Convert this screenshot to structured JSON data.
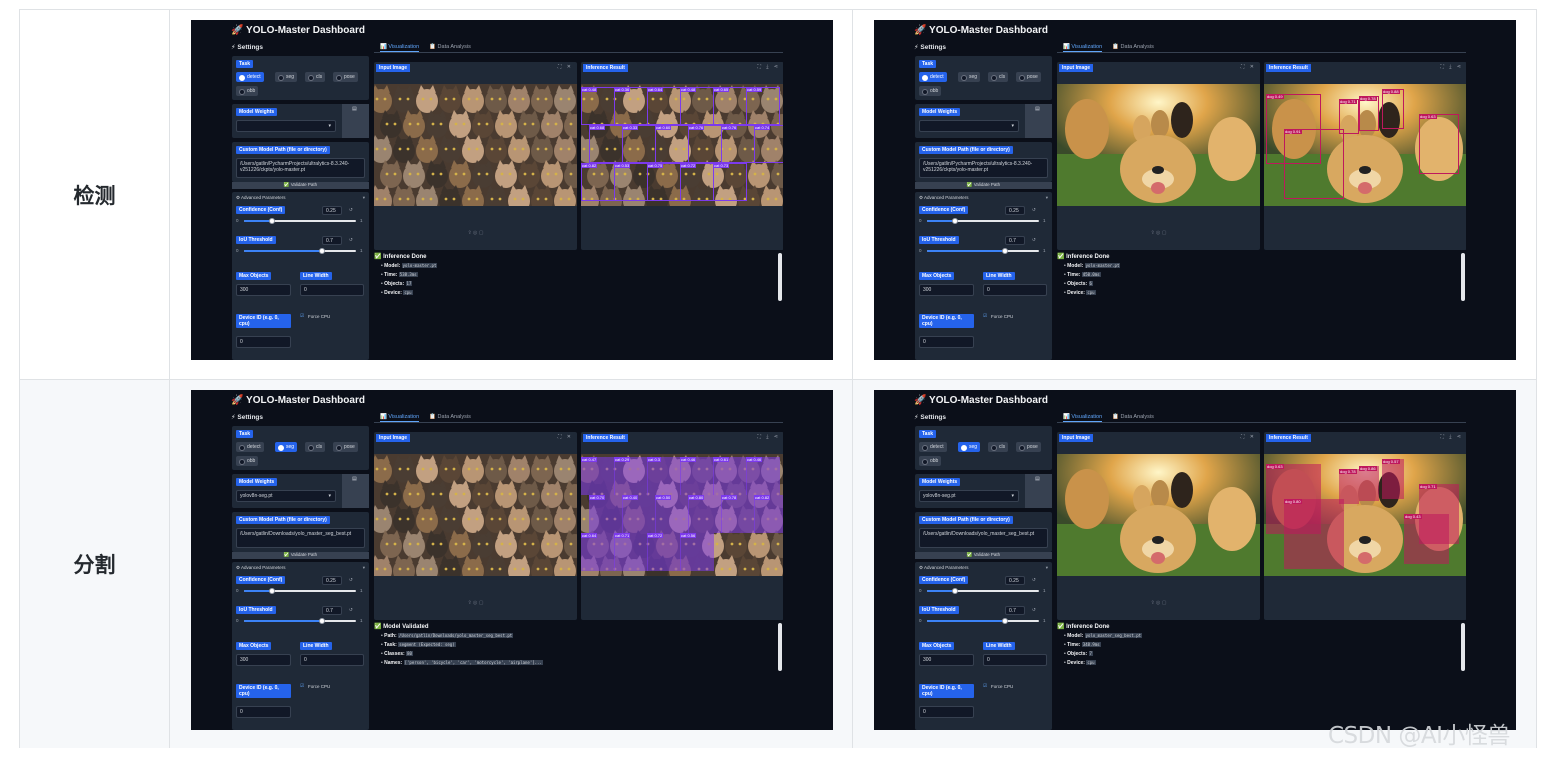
{
  "rows": [
    {
      "label": "检测",
      "shots": [
        {
          "app_title": "🚀 YOLO-Master Dashboard",
          "settings_heading": "⚡ Settings",
          "tabs": [
            "📊 Visualization",
            "📋 Data Analysis"
          ],
          "task_label": "Task",
          "task_options": [
            "detect",
            "seg",
            "cls",
            "pose",
            "obb"
          ],
          "task_selected": "detect",
          "weights_label": "Model Weights",
          "weights_value": "",
          "custom_path_label": "Custom Model Path (file or directory)",
          "custom_path_value": "/Users/gatlin/PycharmProjects/ultralytics-8.3.240-v251226/ckpts/yolo-master.pt",
          "validate_label": "✅ Validate Path",
          "advanced_label": "⚙ Advanced Parameters",
          "conf_label": "Confidence (Conf)",
          "conf_value": "0.25",
          "conf_level": 0.25,
          "iou_label": "IoU Threshold",
          "iou_value": "0.7",
          "iou_level": 0.7,
          "max_obj_label": "Max Objects",
          "max_obj_value": "300",
          "line_width_label": "Line Width",
          "line_width_value": "0",
          "device_label": "Device ID (e.g. 0, cpu)",
          "device_value": "0",
          "force_cpu_label": "Force CPU",
          "input_label": "Input Image",
          "result_label": "Inference Result",
          "image_kind": "cats",
          "result_mode": "det",
          "status_title": "✅ Inference Done",
          "status_items": [
            {
              "k": "Model:",
              "v": "yolo-master.pt"
            },
            {
              "k": "Time:",
              "v": "538.3ms"
            },
            {
              "k": "Objects:",
              "v": "17"
            },
            {
              "k": "Device:",
              "v": "cpu"
            }
          ],
          "det_labels": [
            "cat 0.48",
            "cat 0.36",
            "cat 0.64",
            "cat 0.48",
            "cat 0.65",
            "cat 0.59",
            "cat 0.68",
            "cat 0.33",
            "cat 0.60",
            "cat 0.76",
            "cat 0.76",
            "cat 0.74",
            "cat 0.82",
            "cat 0.53",
            "cat 0.75",
            "cat 0.72",
            "cat 0.73"
          ]
        },
        {
          "app_title": "🚀 YOLO-Master Dashboard",
          "settings_heading": "⚡ Settings",
          "tabs": [
            "📊 Visualization",
            "📋 Data Analysis"
          ],
          "task_label": "Task",
          "task_options": [
            "detect",
            "seg",
            "cls",
            "pose",
            "obb"
          ],
          "task_selected": "detect",
          "weights_label": "Model Weights",
          "weights_value": "",
          "custom_path_label": "Custom Model Path (file or directory)",
          "custom_path_value": "/Users/gatlin/PycharmProjects/ultralytics-8.3.240-v251226/ckpts/yolo-master.pt",
          "validate_label": "✅ Validate Path",
          "advanced_label": "⚙ Advanced Parameters",
          "conf_label": "Confidence (Conf)",
          "conf_value": "0.25",
          "conf_level": 0.25,
          "iou_label": "IoU Threshold",
          "iou_value": "0.7",
          "iou_level": 0.7,
          "max_obj_label": "Max Objects",
          "max_obj_value": "300",
          "line_width_label": "Line Width",
          "line_width_value": "0",
          "device_label": "Device ID (e.g. 0, cpu)",
          "device_value": "0",
          "force_cpu_label": "Force CPU",
          "input_label": "Input Image",
          "result_label": "Inference Result",
          "image_kind": "dogs",
          "result_mode": "det",
          "status_title": "✅ Inference Done",
          "status_items": [
            {
              "k": "Model:",
              "v": "yolo-master.pt"
            },
            {
              "k": "Time:",
              "v": "450.0ms"
            },
            {
              "k": "Objects:",
              "v": "6"
            },
            {
              "k": "Device:",
              "v": "cpu"
            }
          ],
          "det_labels": [
            "dog 0.49",
            "dog 0.71",
            "dog 0.78",
            "dog 0.88",
            "dog 0.63",
            "dog 0.91"
          ]
        }
      ]
    },
    {
      "label": "分割",
      "shots": [
        {
          "app_title": "🚀 YOLO-Master Dashboard",
          "settings_heading": "⚡ Settings",
          "tabs": [
            "📊 Visualization",
            "📋 Data Analysis"
          ],
          "task_label": "Task",
          "task_options": [
            "detect",
            "seg",
            "cls",
            "pose",
            "obb"
          ],
          "task_selected": "seg",
          "weights_label": "Model Weights",
          "weights_value": "yolov8n-seg.pt",
          "custom_path_label": "Custom Model Path (file or directory)",
          "custom_path_value": "/Users/gatlin/Downloads/yolo_master_seg_best.pt",
          "validate_label": "✅ Validate Path",
          "advanced_label": "⚙ Advanced Parameters",
          "conf_label": "Confidence (Conf)",
          "conf_value": "0.25",
          "conf_level": 0.25,
          "iou_label": "IoU Threshold",
          "iou_value": "0.7",
          "iou_level": 0.7,
          "max_obj_label": "Max Objects",
          "max_obj_value": "300",
          "line_width_label": "Line Width",
          "line_width_value": "0",
          "device_label": "Device ID (e.g. 0, cpu)",
          "device_value": "0",
          "force_cpu_label": "Force CPU",
          "input_label": "Input Image",
          "result_label": "Inference Result",
          "image_kind": "cats",
          "result_mode": "seg",
          "status_title": "✅ Model Validated",
          "status_items": [
            {
              "k": "Path:",
              "v": "/Users/gatlin/Downloads/yolo_master_seg_best.pt"
            },
            {
              "k": "Task:",
              "v": "segment (Expected: seg)"
            },
            {
              "k": "Classes:",
              "v": "80"
            },
            {
              "k": "Names:",
              "v": "['person', 'bicycle', 'car', 'motorcycle', 'airplane']..."
            }
          ],
          "det_labels": [
            "cat 0.47",
            "cat 0.29",
            "cat 0.3",
            "cat 0.46",
            "cat 0.61",
            "cat 0.46",
            "cat 0.70",
            "cat 0.40",
            "cat 0.50",
            "cat 0.80",
            "cat 0.78",
            "cat 0.82",
            "cat 0.64",
            "cat 0.71",
            "cat 0.72",
            "cat 0.56"
          ]
        },
        {
          "app_title": "🚀 YOLO-Master Dashboard",
          "settings_heading": "⚡ Settings",
          "tabs": [
            "📊 Visualization",
            "📋 Data Analysis"
          ],
          "task_label": "Task",
          "task_options": [
            "detect",
            "seg",
            "cls",
            "pose",
            "obb"
          ],
          "task_selected": "seg",
          "weights_label": "Model Weights",
          "weights_value": "yolov8n-seg.pt",
          "custom_path_label": "Custom Model Path (file or directory)",
          "custom_path_value": "/Users/gatlin/Downloads/yolo_master_seg_best.pt",
          "validate_label": "✅ Validate Path",
          "advanced_label": "⚙ Advanced Parameters",
          "conf_label": "Confidence (Conf)",
          "conf_value": "0.25",
          "conf_level": 0.25,
          "iou_label": "IoU Threshold",
          "iou_value": "0.7",
          "iou_level": 0.7,
          "max_obj_label": "Max Objects",
          "max_obj_value": "300",
          "line_width_label": "Line Width",
          "line_width_value": "0",
          "device_label": "Device ID (e.g. 0, cpu)",
          "device_value": "0",
          "force_cpu_label": "Force CPU",
          "input_label": "Input Image",
          "result_label": "Inference Result",
          "image_kind": "dogs",
          "result_mode": "seg",
          "status_title": "✅ Inference Done",
          "status_items": [
            {
              "k": "Model:",
              "v": "yolo_master_seg_best.pt"
            },
            {
              "k": "Time:",
              "v": "348.9ms"
            },
            {
              "k": "Objects:",
              "v": "7"
            },
            {
              "k": "Device:",
              "v": "cpu"
            }
          ],
          "det_labels": [
            "dog 0.63",
            "dog 0.78",
            "dog 0.86",
            "dog 0.57",
            "dog 0.71",
            "dog 0.80",
            "dog 0.43"
          ]
        }
      ]
    }
  ],
  "watermark": "CSDN @AI小怪兽",
  "colors": {
    "accent": "#2563eb",
    "app_bg": "#0b0f19",
    "panel": "#1f2937",
    "box": "#7c3aed",
    "dog_box": "#be185d"
  }
}
